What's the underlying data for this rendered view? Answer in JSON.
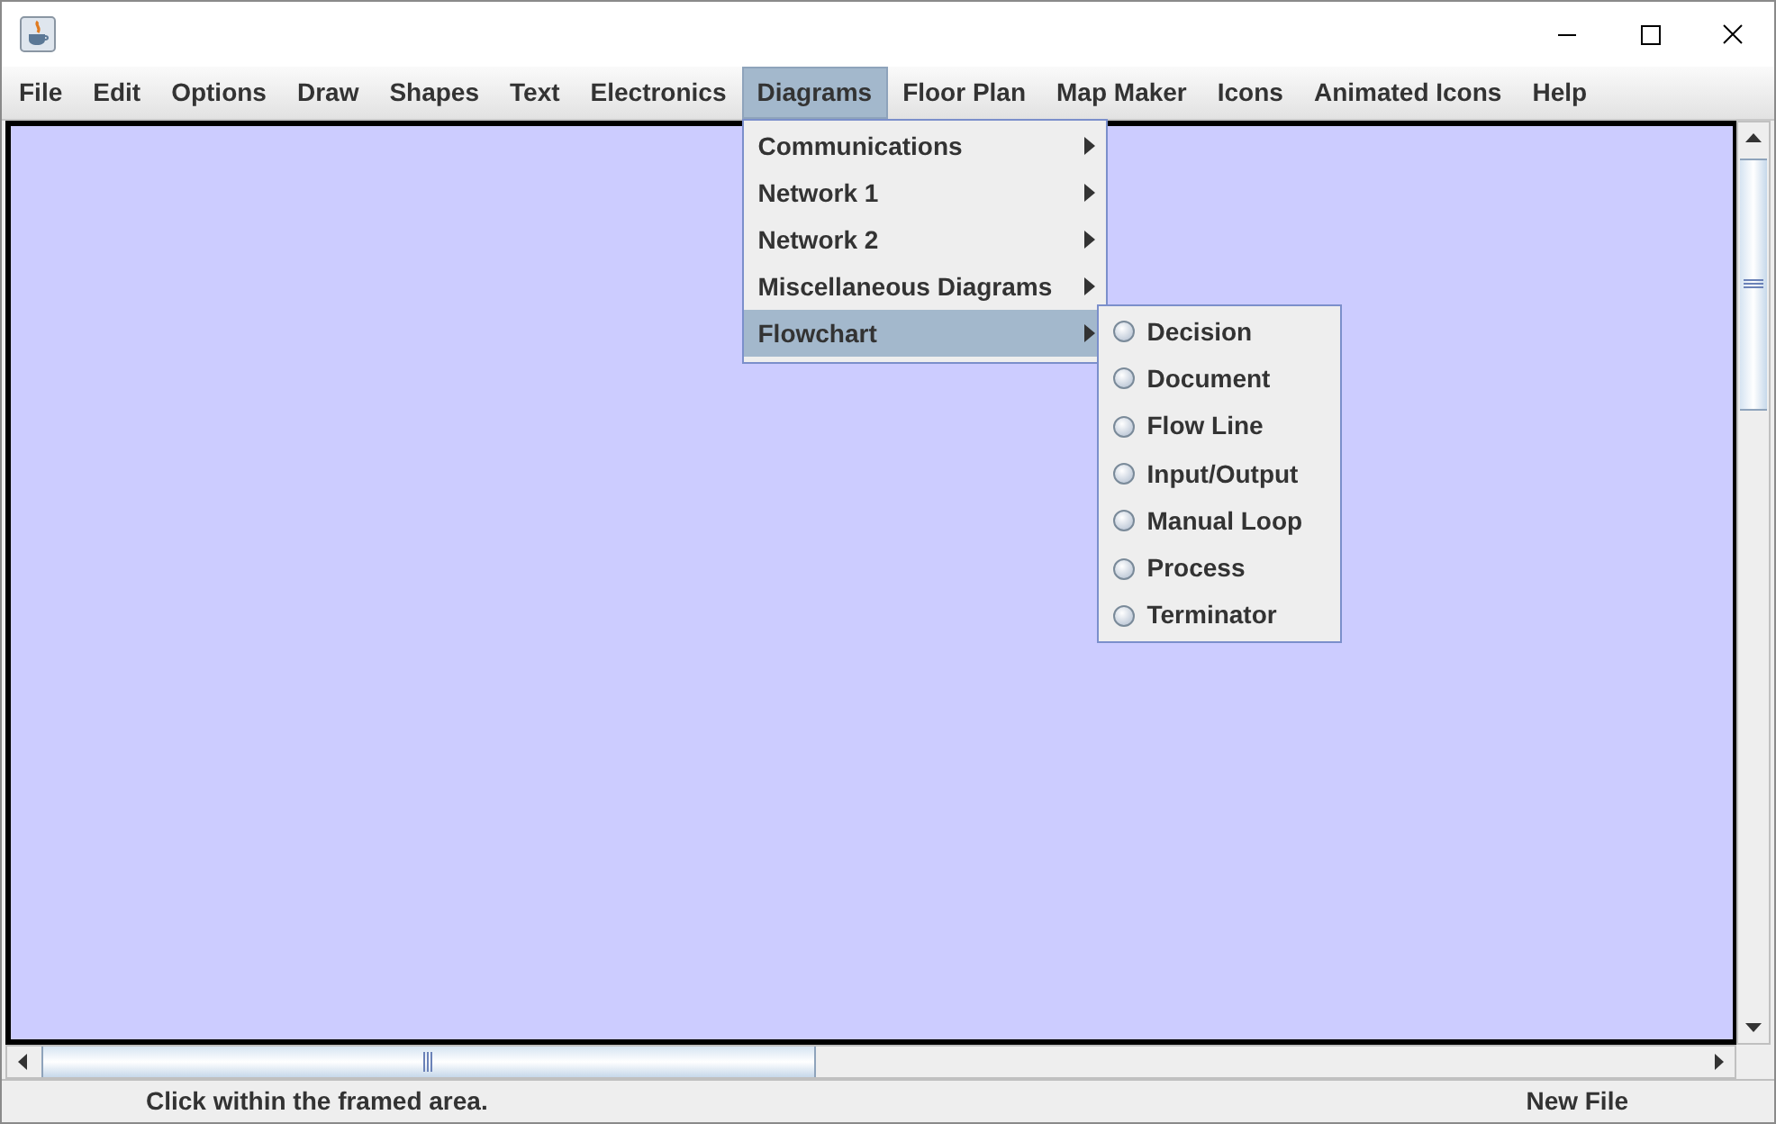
{
  "menubar": [
    {
      "label": "File",
      "selected": false
    },
    {
      "label": "Edit",
      "selected": false
    },
    {
      "label": "Options",
      "selected": false
    },
    {
      "label": "Draw",
      "selected": false
    },
    {
      "label": "Shapes",
      "selected": false
    },
    {
      "label": "Text",
      "selected": false
    },
    {
      "label": "Electronics",
      "selected": false
    },
    {
      "label": "Diagrams",
      "selected": true
    },
    {
      "label": "Floor Plan",
      "selected": false
    },
    {
      "label": "Map Maker",
      "selected": false
    },
    {
      "label": "Icons",
      "selected": false
    },
    {
      "label": "Animated Icons",
      "selected": false
    },
    {
      "label": "Help",
      "selected": false
    }
  ],
  "dropdown": {
    "items": [
      {
        "label": "Communications",
        "selected": false
      },
      {
        "label": "Network 1",
        "selected": false
      },
      {
        "label": "Network 2",
        "selected": false
      },
      {
        "label": "Miscellaneous Diagrams",
        "selected": false
      },
      {
        "label": "Flowchart",
        "selected": true
      }
    ]
  },
  "submenu": {
    "items": [
      {
        "label": "Decision",
        "checked": false
      },
      {
        "label": "Document",
        "checked": false
      },
      {
        "label": "Flow Line",
        "checked": false
      },
      {
        "label": "Input/Output",
        "checked": false
      },
      {
        "label": "Manual Loop",
        "checked": false
      },
      {
        "label": "Process",
        "checked": false
      },
      {
        "label": "Terminator",
        "checked": false
      }
    ]
  },
  "status_bar": {
    "message": "Click within the framed area.",
    "file": "New File"
  }
}
